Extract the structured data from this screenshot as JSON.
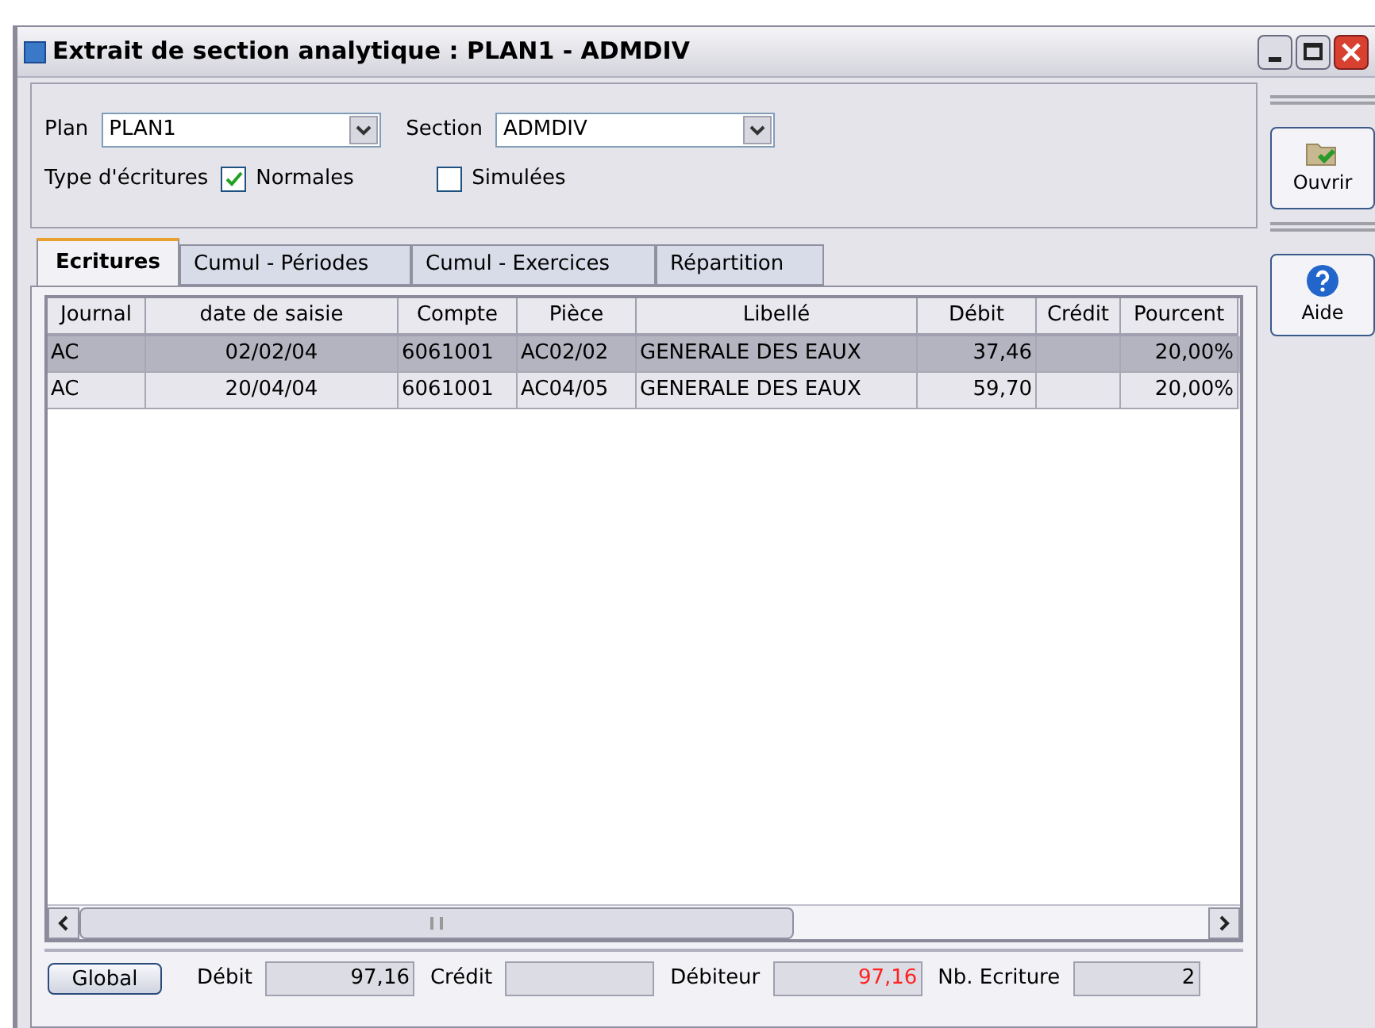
{
  "window": {
    "title": "Extrait de section analytique : PLAN1 - ADMDIV"
  },
  "filters": {
    "plan_label": "Plan",
    "plan_value": "PLAN1",
    "section_label": "Section",
    "section_value": "ADMDIV",
    "type_label": "Type d'écritures",
    "checkboxes": [
      {
        "label": "Normales",
        "checked": true
      },
      {
        "label": "Simulées",
        "checked": false
      }
    ]
  },
  "tabs": [
    {
      "label": "Ecritures",
      "selected": true
    },
    {
      "label": "Cumul - Périodes",
      "selected": false
    },
    {
      "label": "Cumul - Exercices",
      "selected": false
    },
    {
      "label": "Répartition",
      "selected": false
    }
  ],
  "table": {
    "columns": [
      "Journal",
      "date de saisie",
      "Compte",
      "Pièce",
      "Libellé",
      "Débit",
      "Crédit",
      "Pourcent"
    ],
    "rows": [
      {
        "selected": true,
        "cells": [
          "AC",
          "02/02/04",
          "6061001",
          "AC02/02",
          "GENERALE DES EAUX",
          "37,46",
          null,
          "20,00%"
        ]
      },
      {
        "selected": false,
        "cells": [
          "AC",
          "20/04/04",
          "6061001",
          "AC04/05",
          "GENERALE DES EAUX",
          "59,70",
          null,
          "20,00%"
        ]
      }
    ]
  },
  "footer": {
    "button": "Global",
    "fields": [
      {
        "label": "Débit",
        "value": "97,16",
        "kind": "normal"
      },
      {
        "label": "Crédit",
        "kind": "normal"
      },
      {
        "label": "Débiteur",
        "value": "97,16",
        "kind": "alert"
      },
      {
        "label": "Nb. Ecriture",
        "value": "2",
        "kind": "normal"
      }
    ]
  },
  "side_buttons": [
    {
      "label": "Ouvrir",
      "kind": "open"
    },
    {
      "label": "Aide",
      "kind": "help"
    }
  ]
}
